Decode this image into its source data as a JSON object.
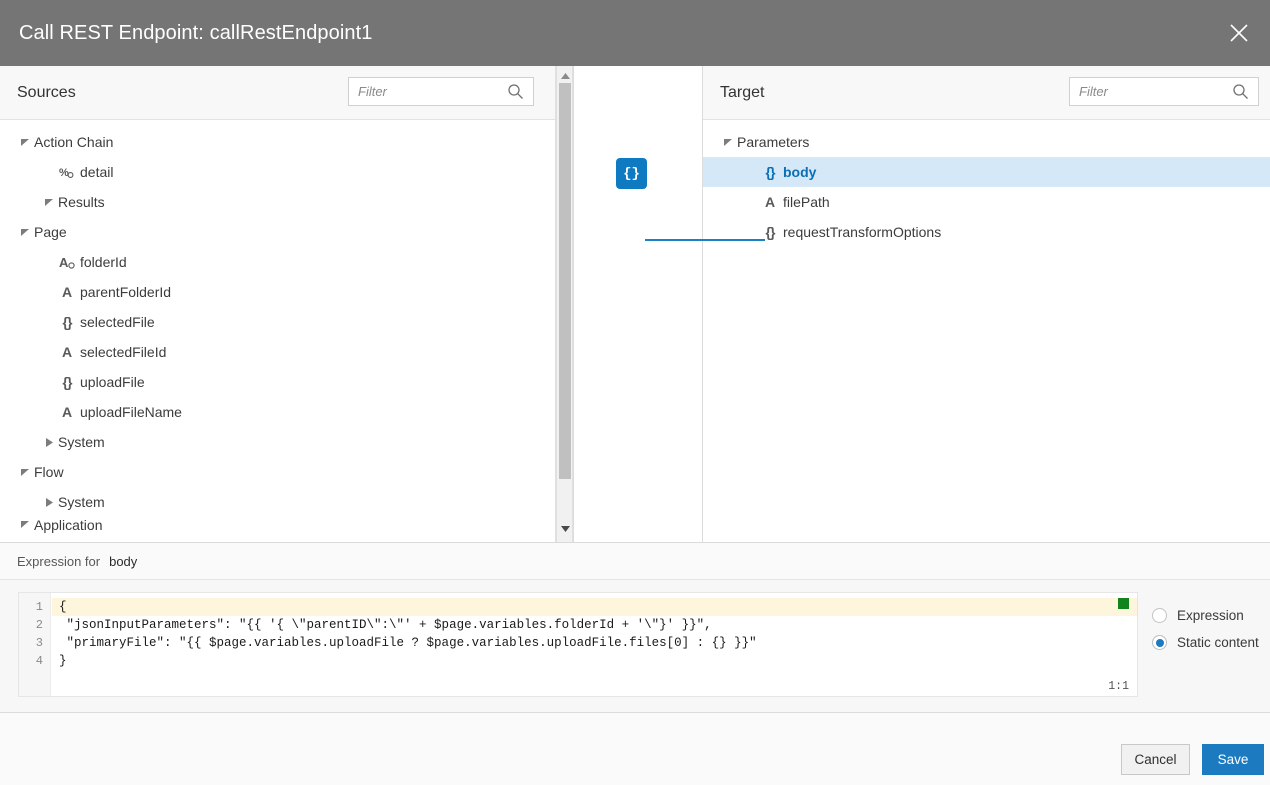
{
  "window": {
    "title": "Call REST Endpoint: callRestEndpoint1",
    "close_icon": "close-icon"
  },
  "sources": {
    "title": "Sources",
    "filter_placeholder": "Filter",
    "filter_value": "",
    "search_icon": "search-icon",
    "tree": [
      {
        "label": "Action Chain",
        "indent": 0,
        "twisty": "expanded",
        "icon": null
      },
      {
        "label": "detail",
        "indent": 1,
        "twisty": "none",
        "icon": "any-type"
      },
      {
        "label": "Results",
        "indent": 1,
        "twisty": "expanded",
        "icon": null
      },
      {
        "label": "Page",
        "indent": 0,
        "twisty": "expanded",
        "icon": null
      },
      {
        "label": "folderId",
        "indent": 1,
        "twisty": "none",
        "icon": "string-default"
      },
      {
        "label": "parentFolderId",
        "indent": 1,
        "twisty": "none",
        "icon": "string"
      },
      {
        "label": "selectedFile",
        "indent": 1,
        "twisty": "none",
        "icon": "object"
      },
      {
        "label": "selectedFileId",
        "indent": 1,
        "twisty": "none",
        "icon": "string"
      },
      {
        "label": "uploadFile",
        "indent": 1,
        "twisty": "none",
        "icon": "object"
      },
      {
        "label": "uploadFileName",
        "indent": 1,
        "twisty": "none",
        "icon": "string"
      },
      {
        "label": "System",
        "indent": 1,
        "twisty": "collapsed",
        "icon": null
      },
      {
        "label": "Flow",
        "indent": 0,
        "twisty": "expanded",
        "icon": null
      },
      {
        "label": "System",
        "indent": 1,
        "twisty": "collapsed",
        "icon": null
      },
      {
        "label": "Application",
        "indent": 0,
        "twisty": "expanded",
        "icon": null
      }
    ]
  },
  "scrollbar": {
    "up_icon": "scroll-up-arrow-icon",
    "down_icon": "scroll-down-arrow-icon"
  },
  "mapper": {
    "node_label": "{}"
  },
  "target": {
    "title": "Target",
    "filter_placeholder": "Filter",
    "filter_value": "",
    "search_icon": "search-icon",
    "tree": [
      {
        "label": "Parameters",
        "indent": 0,
        "twisty": "expanded",
        "icon": null,
        "selected": false
      },
      {
        "label": "body",
        "indent": 1,
        "twisty": "none",
        "icon": "object",
        "selected": true
      },
      {
        "label": "filePath",
        "indent": 1,
        "twisty": "none",
        "icon": "string",
        "selected": false
      },
      {
        "label": "requestTransformOptions",
        "indent": 1,
        "twisty": "none",
        "icon": "object",
        "selected": false
      }
    ]
  },
  "expression": {
    "label": "Expression for",
    "target_name": "body",
    "line_numbers": [
      "1",
      "2",
      "3",
      "4"
    ],
    "lines": [
      "{",
      " \"jsonInputParameters\": \"{{ '{ \\\"parentID\\\":\\\"' + $page.variables.folderId + '\\\"}' }}\",",
      " \"primaryFile\": \"{{ $page.variables.uploadFile ? $page.variables.uploadFile.files[0] : {} }}\"",
      "}"
    ],
    "active_line": 1,
    "cursor_position": "1:1",
    "status_marker_color": "#11841b",
    "mode_options": [
      {
        "label": "Expression",
        "selected": false
      },
      {
        "label": "Static content",
        "selected": true
      }
    ]
  },
  "footer": {
    "cancel_label": "Cancel",
    "save_label": "Save"
  },
  "colors": {
    "titlebar": "#757575",
    "accent": "#1c7ac0",
    "selection": "#d4e8f7",
    "active_line": "#fdf6dd",
    "status_green": "#11841b"
  }
}
